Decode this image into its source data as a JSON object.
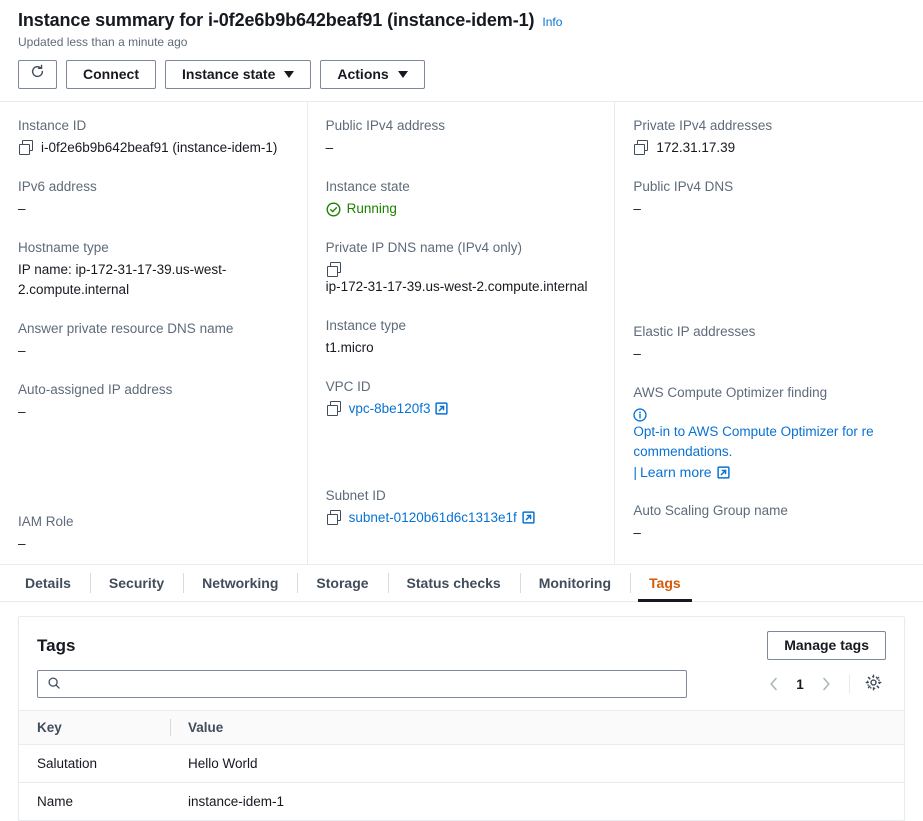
{
  "header": {
    "title": "Instance summary for i-0f2e6b9b642beaf91 (instance-idem-1)",
    "info_label": "Info",
    "updated": "Updated less than a minute ago",
    "buttons": {
      "refresh": "refresh-icon",
      "connect": "Connect",
      "instance_state": "Instance state",
      "actions": "Actions"
    }
  },
  "summary": {
    "col1": [
      {
        "label": "Instance ID",
        "value": "i-0f2e6b9b642beaf91 (instance-idem-1)",
        "copyable": true
      },
      {
        "label": "IPv6 address",
        "value": "–"
      },
      {
        "label": "Hostname type",
        "value": "IP name: ip-172-31-17-39.us-west-2.compute.internal"
      },
      {
        "label": "Answer private resource DNS name",
        "value": "–"
      },
      {
        "label": "Auto-assigned IP address",
        "value": "–"
      },
      {
        "label": "IAM Role",
        "value": "–"
      }
    ],
    "col2": [
      {
        "label": "Public IPv4 address",
        "value": "–"
      },
      {
        "label": "Instance state",
        "value": "Running",
        "status": "running"
      },
      {
        "label": "Private IP DNS name (IPv4 only)",
        "value": "ip-172-31-17-39.us-west-2.compute.internal",
        "copyable": true
      },
      {
        "label": "Instance type",
        "value": "t1.micro"
      },
      {
        "label": "VPC ID",
        "value": "vpc-8be120f3",
        "copyable": true,
        "link": true
      },
      {
        "label": "Subnet ID",
        "value": "subnet-0120b61d6c1313e1f",
        "copyable": true,
        "link": true
      }
    ],
    "col3": [
      {
        "label": "Private IPv4 addresses",
        "value": "172.31.17.39",
        "copyable": true
      },
      {
        "label": "Public IPv4 DNS",
        "value": "–"
      },
      {
        "label": "Elastic IP addresses",
        "value": "–"
      },
      {
        "label": "AWS Compute Optimizer finding",
        "value": "Opt-in to AWS Compute Optimizer for re commendations.",
        "learn_more": "Learn more"
      },
      {
        "label": "Auto Scaling Group name",
        "value": "–"
      }
    ]
  },
  "optimizer": {
    "label": "AWS Compute Optimizer finding",
    "text": "Opt-in to AWS Compute Optimizer for re commendations.",
    "learn_more": "Learn more"
  },
  "tabs": [
    {
      "label": "Details",
      "active": false
    },
    {
      "label": "Security",
      "active": false
    },
    {
      "label": "Networking",
      "active": false
    },
    {
      "label": "Storage",
      "active": false
    },
    {
      "label": "Status checks",
      "active": false
    },
    {
      "label": "Monitoring",
      "active": false
    },
    {
      "label": "Tags",
      "active": true
    }
  ],
  "tags_panel": {
    "title": "Tags",
    "manage_button": "Manage tags",
    "search_value": "",
    "search_placeholder": "",
    "page_number": "1",
    "columns": {
      "key": "Key",
      "value": "Value"
    },
    "rows": [
      {
        "key": "Salutation",
        "value": "Hello World"
      },
      {
        "key": "Name",
        "value": "instance-idem-1"
      }
    ]
  },
  "colors": {
    "link": "#0972d3",
    "active_tab": "#d45b07",
    "status_running": "#1d8102",
    "label": "#5f6b7a"
  }
}
